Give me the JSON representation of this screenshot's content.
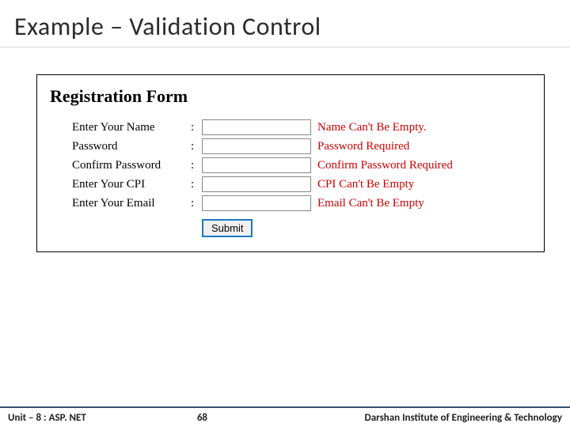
{
  "slide": {
    "title": "Example – Validation Control"
  },
  "form": {
    "heading": "Registration Form",
    "rows": [
      {
        "label": "Enter Your Name",
        "value": "",
        "error": "Name Can't Be Empty.",
        "type": "text"
      },
      {
        "label": "Password",
        "value": "",
        "error": "Password Required",
        "type": "password"
      },
      {
        "label": "Confirm Password",
        "value": "",
        "error": "Confirm Password Required",
        "type": "password"
      },
      {
        "label": "Enter Your CPI",
        "value": "",
        "error": "CPI Can't Be Empty",
        "type": "text"
      },
      {
        "label": "Enter Your Email",
        "value": "",
        "error": "Email Can't Be Empty",
        "type": "text"
      }
    ],
    "submit_label": "Submit"
  },
  "footer": {
    "left": "Unit – 8 : ASP. NET",
    "page": "68",
    "right": "Darshan Institute of Engineering & Technology"
  }
}
